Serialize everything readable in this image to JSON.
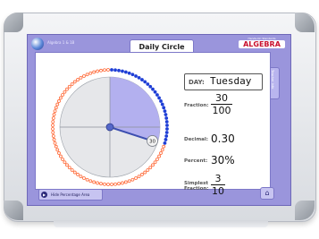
{
  "header": {
    "app_caption": "Algebra 1 & 1B",
    "title": "Daily Circle",
    "brand_sub": "Hands-On Standards",
    "brand_main": "ALGEBRA"
  },
  "side_tab": {
    "label": "Teacher Info"
  },
  "circle": {
    "total_beads": 100,
    "filled_beads": 30,
    "pointer_value": "30",
    "filled_color": "#1f3fd6",
    "empty_color": "#ff6633",
    "shaded_color": "#b3b0ef",
    "unshaded_color": "#e6e7ea"
  },
  "panel": {
    "day_label": "DAY:",
    "day_value": "Tuesday",
    "fraction_label": "Fraction:",
    "fraction_numerator": "30",
    "fraction_denominator": "100",
    "decimal_label": "Decimal:",
    "decimal_value": "0.30",
    "percent_label": "Percent:",
    "percent_value": "30%",
    "simplest_label_1": "Simplest",
    "simplest_label_2": "Fraction:",
    "simplest_numerator": "3",
    "simplest_denominator": "10"
  },
  "footer": {
    "play_icon": "play-icon",
    "play_label": "Hide Percentage Area",
    "home_icon": "home-icon"
  }
}
